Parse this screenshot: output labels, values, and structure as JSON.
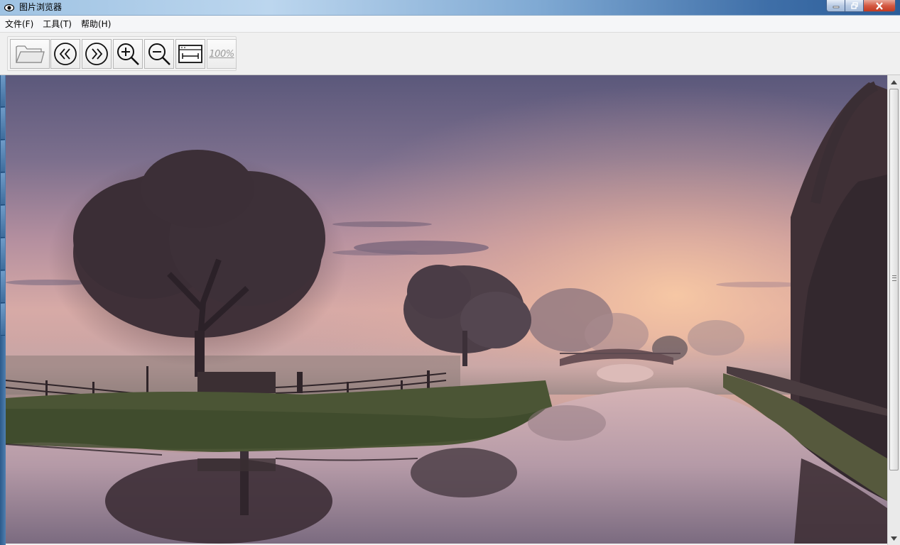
{
  "window": {
    "title": "图片浏览器"
  },
  "menu": {
    "items": [
      {
        "label": "文件(F)"
      },
      {
        "label": "工具(T)"
      },
      {
        "label": "帮助(H)"
      }
    ]
  },
  "toolbar": {
    "buttons": [
      {
        "name": "open",
        "icon": "folder-icon"
      },
      {
        "name": "previous",
        "icon": "double-chevron-left-icon"
      },
      {
        "name": "next",
        "icon": "double-chevron-right-icon"
      },
      {
        "name": "zoom-in",
        "icon": "zoom-in-icon"
      },
      {
        "name": "zoom-out",
        "icon": "zoom-out-icon"
      },
      {
        "name": "fit-width",
        "icon": "fit-width-icon"
      },
      {
        "name": "actual-size",
        "icon": "actual-size-icon",
        "label": "100%"
      }
    ]
  },
  "viewer": {
    "image_subject": "misty river at sunrise",
    "colors": {
      "sky_top": "#5d5a7d",
      "sky_glow": "#f2c0a0",
      "water": "#c9a9b3",
      "grass": "#4d5a36"
    }
  }
}
